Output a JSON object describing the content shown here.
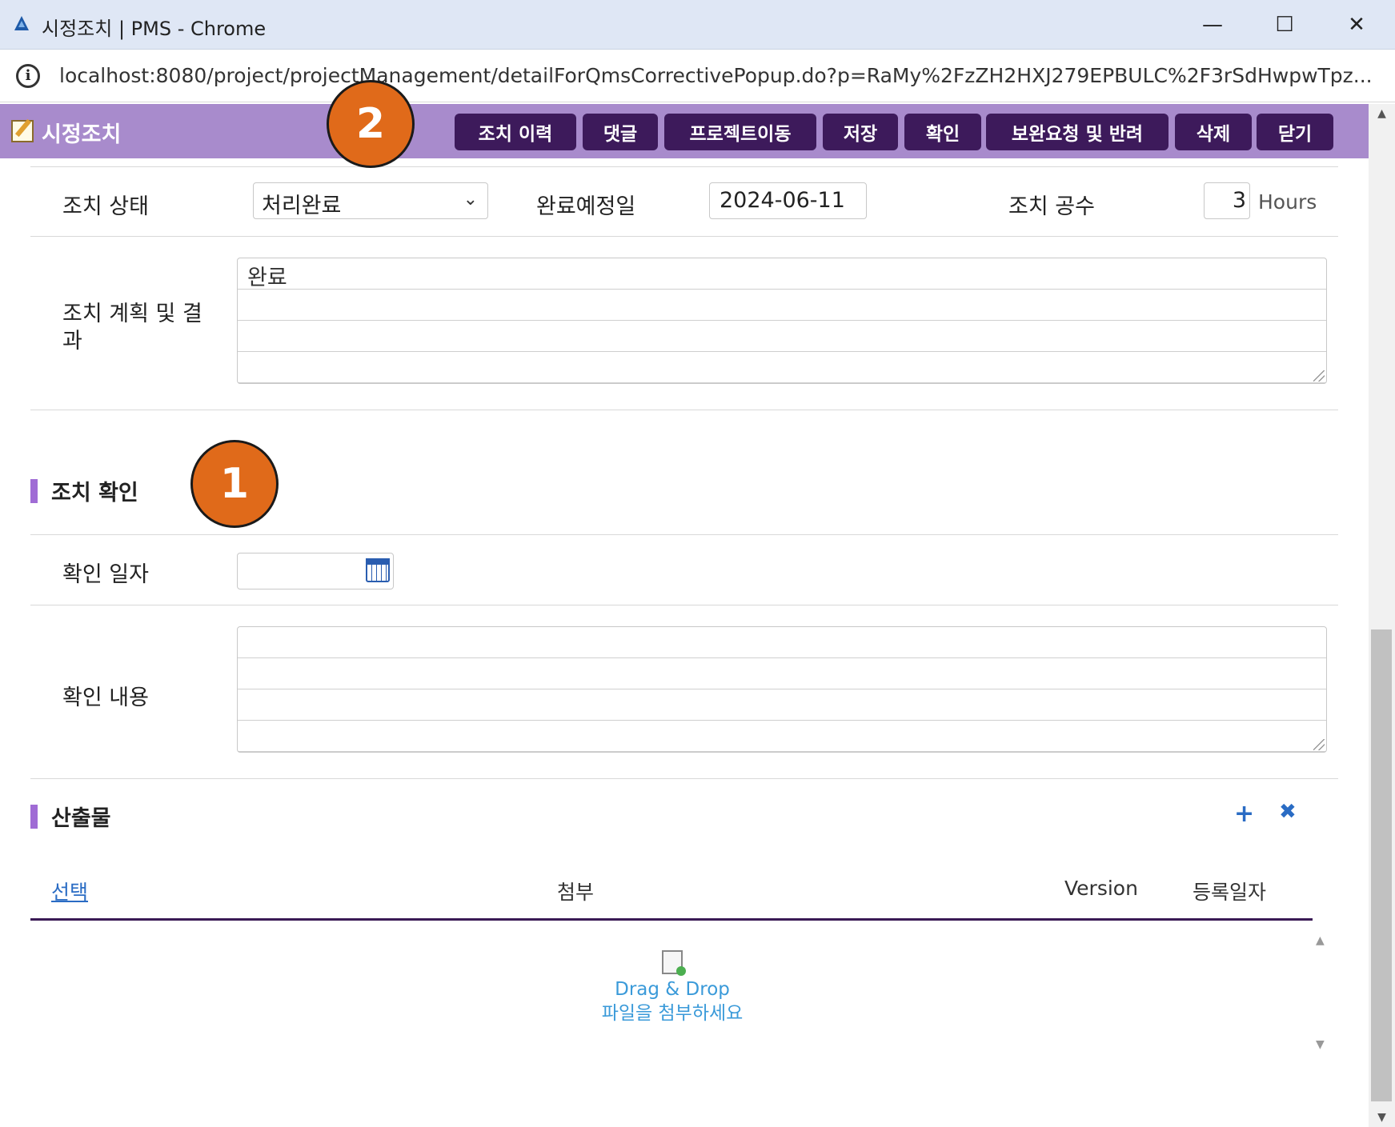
{
  "window": {
    "title": "시정조치 | PMS - Chrome",
    "url": "localhost:8080/project/projectManagement/detailForQmsCorrectivePopup.do?p=RaMy%2FzZH2HXJ279EPBULC%2F3rSdHwpwTpz...",
    "min_glyph": "—",
    "max_glyph": "☐",
    "close_glyph": "✕"
  },
  "header": {
    "title": "시정조치",
    "buttons": [
      "조치 이력",
      "댓글",
      "프로젝트이동",
      "저장",
      "확인",
      "보완요청 및 반려",
      "삭제",
      "닫기"
    ]
  },
  "action": {
    "status_label": "조치 상태",
    "status_value": "처리완료",
    "due_label": "완료예정일",
    "due_value": "2024-06-11",
    "effort_label": "조치 공수",
    "effort_value": "3",
    "effort_unit": "Hours",
    "plan_label_line1": "조치 계획 및 결",
    "plan_label_line2": "과",
    "plan_value": "완료"
  },
  "confirm": {
    "section_title": "조치 확인",
    "date_label": "확인 일자",
    "date_value": "",
    "content_label": "확인 내용",
    "content_value": ""
  },
  "outputs": {
    "section_title": "산출물",
    "add_icon": "+",
    "remove_icon": "✖",
    "columns": [
      "선택",
      "첨부",
      "Version",
      "등록일자"
    ],
    "drop_line1": "Drag & Drop",
    "drop_line2": "파일을 첨부하세요"
  },
  "annotations": [
    "1",
    "2"
  ],
  "colors": {
    "header_bg": "#a88bcc",
    "button_bg": "#3d1a5b",
    "section_accent": "#a06cd5",
    "badge": "#e06a1a"
  }
}
